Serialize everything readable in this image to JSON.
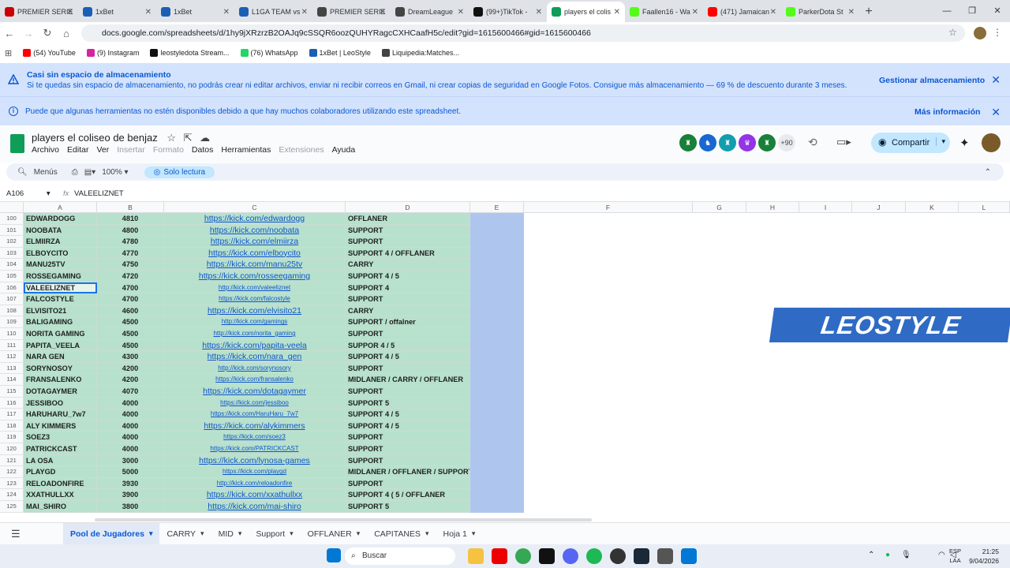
{
  "browser": {
    "tabs": [
      {
        "label": "PREMIER SERIE",
        "color": "#c00"
      },
      {
        "label": "1xBet",
        "color": "#1a5fb4"
      },
      {
        "label": "1xBet",
        "color": "#1a5fb4"
      },
      {
        "label": "L1GA TEAM vs",
        "color": "#1a5fb4"
      },
      {
        "label": "PREMIER SERIE",
        "color": "#444"
      },
      {
        "label": "DreamLeague",
        "color": "#444"
      },
      {
        "label": "(99+)TikTok -",
        "color": "#111"
      },
      {
        "label": "players el colis",
        "color": "#0f9d58",
        "active": true
      },
      {
        "label": "Faallen16 - Wa",
        "color": "#53fc18"
      },
      {
        "label": "(471) Jamaican",
        "color": "#f00"
      },
      {
        "label": "ParkerDota St",
        "color": "#53fc18"
      }
    ],
    "url": "docs.google.com/spreadsheets/d/1hy9jXRzrzB2OAJq9cSSQR6oozQUHYRagcCXHCaafH5c/edit?gid=1615600466#gid=1615600466",
    "bookmarks": [
      "(54) YouTube",
      "(9) Instagram",
      "leostyledota Stream...",
      "(76) WhatsApp",
      "1xBet | LeoStyle",
      "Liquipedia:Matches..."
    ]
  },
  "banner_storage": {
    "title": "Casi sin espacio de almacenamiento",
    "text": "Si te quedas sin espacio de almacenamiento, no podrás crear ni editar archivos, enviar ni recibir correos en Gmail, ni crear copias de seguridad en Google Fotos. Consigue más almacenamiento — 69 % de descuento durante 3 meses.",
    "action": "Gestionar almacenamiento"
  },
  "banner_collab": {
    "text": "Puede que algunas herramientas no estén disponibles debido a que hay muchos colaboradores utilizando este spreadsheet.",
    "action": "Más información"
  },
  "doc": {
    "title": "players el coliseo de benjaz",
    "menus": [
      {
        "label": "Archivo"
      },
      {
        "label": "Editar"
      },
      {
        "label": "Ver"
      },
      {
        "label": "Insertar",
        "disabled": true
      },
      {
        "label": "Formato",
        "disabled": true
      },
      {
        "label": "Datos"
      },
      {
        "label": "Herramientas"
      },
      {
        "label": "Extensiones",
        "disabled": true
      },
      {
        "label": "Ayuda"
      }
    ],
    "collaborators_more": "+90",
    "share_label": "Compartir"
  },
  "toolbar": {
    "menus_label": "Menús",
    "zoom": "100%",
    "readonly_label": "Solo lectura"
  },
  "formula_bar": {
    "name_box": "A106",
    "value": "VALEELIZNET"
  },
  "columns": [
    "A",
    "B",
    "C",
    "D",
    "E",
    "F",
    "G",
    "H",
    "I",
    "J",
    "K",
    "L"
  ],
  "rows": [
    {
      "n": "100",
      "name": "EDWARDOGG",
      "score": "4810",
      "link": "https://kick.com/edwardogg",
      "role": "OFFLANER"
    },
    {
      "n": "101",
      "name": "NOOBATA",
      "score": "4800",
      "link": "https://kick.com/noobata",
      "role": "SUPPORT"
    },
    {
      "n": "102",
      "name": "ELMIIRZA",
      "score": "4780",
      "link": "https://kick.com/elmiirza",
      "role": "SUPPORT"
    },
    {
      "n": "103",
      "name": "ELBOYCITO",
      "score": "4770",
      "link": "https://kick.com/elboycito",
      "role": "SUPPORT 4 / OFFLANER"
    },
    {
      "n": "104",
      "name": "MANU25TV",
      "score": "4750",
      "link": "https://kick.com/manu25tv",
      "role": "CARRY"
    },
    {
      "n": "105",
      "name": "ROSSEGAMING",
      "score": "4720",
      "link": "https://kick.com/rosseegaming",
      "role": "SUPPORT 4 / 5"
    },
    {
      "n": "106",
      "name": "VALEELIZNET",
      "score": "4700",
      "link": "http://kick.com/valeeliznet",
      "role": "SUPPORT 4",
      "selected": true,
      "small": true
    },
    {
      "n": "107",
      "name": "FALCOSTYLE",
      "score": "4700",
      "link": "https://kick.com/falcostyle",
      "role": "SUPPORT",
      "small": true
    },
    {
      "n": "108",
      "name": "ELVISITO21",
      "score": "4600",
      "link": "https://kick.com/elvisito21",
      "role": "CARRY"
    },
    {
      "n": "109",
      "name": "BALIGAMING",
      "score": "4500",
      "link": "http://kick.com/gamings",
      "role": "SUPPORT / offalner",
      "small": true
    },
    {
      "n": "110",
      "name": "NORITA GAMING",
      "score": "4500",
      "link": "http://kick.com/norita_gaming",
      "role": "SUPPORT",
      "small": true
    },
    {
      "n": "111",
      "name": "PAPITA_VEELA",
      "score": "4500",
      "link": "https://kick.com/papita-veela",
      "role": "SUPPOR 4 / 5"
    },
    {
      "n": "112",
      "name": "NARA GEN",
      "score": "4300",
      "link": "https://kick.com/nara_gen",
      "role": "SUPPORT 4 / 5"
    },
    {
      "n": "113",
      "name": "SORYNOSOY",
      "score": "4200",
      "link": "http://kick.com/sorynosory",
      "role": "SUPPORT",
      "small": true
    },
    {
      "n": "114",
      "name": "FRANSALENKO",
      "score": "4200",
      "link": "https://kick.com/fransalenko",
      "role": "MIDLANER / CARRY / OFFLANER",
      "small": true
    },
    {
      "n": "115",
      "name": "DOTAGAYMER",
      "score": "4070",
      "link": "https://kick.com/dotagaymer",
      "role": "SUPPORT"
    },
    {
      "n": "116",
      "name": "JESSIBOO",
      "score": "4000",
      "link": "https://kick.com/jessiboo",
      "role": "SUPPORT 5",
      "small": true
    },
    {
      "n": "117",
      "name": "HARUHARU_7w7",
      "score": "4000",
      "link": "https://kick.com/HaruHaru_7w7",
      "role": "SUPPORT 4 / 5",
      "small": true
    },
    {
      "n": "118",
      "name": "ALY KIMMERS",
      "score": "4000",
      "link": "https://kick.com/alykimmers",
      "role": "SUPPORT 4 / 5"
    },
    {
      "n": "119",
      "name": "SOEZ3",
      "score": "4000",
      "link": "https://kick.com/soez3",
      "role": "SUPPORT",
      "small": true
    },
    {
      "n": "120",
      "name": "PATRICKCAST",
      "score": "4000",
      "link": "https://kick.com/PATRICKCAST",
      "role": "SUPPORT",
      "small": true
    },
    {
      "n": "121",
      "name": "LA OSA",
      "score": "3000",
      "link": "https://kick.com/lynosa-games",
      "role": "SUPPORT"
    },
    {
      "n": "122",
      "name": "PLAYGD",
      "score": "5000",
      "link": "https://kick.com/playgd",
      "role": "MIDLANER / OFFLANER / SUPPORT",
      "small": true
    },
    {
      "n": "123",
      "name": "RELOADONFIRE",
      "score": "3930",
      "link": "http://kick.com/reloadonfire",
      "role": "SUPPORT",
      "small": true
    },
    {
      "n": "124",
      "name": "XXATHULLXX",
      "score": "3900",
      "link": "https://kick.com/xxathullxx",
      "role": "SUPPORT 4 ( 5 / OFFLANER"
    },
    {
      "n": "125",
      "name": "MAI_SHIRO",
      "score": "3800",
      "link": "https://kick.com/mai-shiro",
      "role": "SUPPORT 5"
    }
  ],
  "watermark": "LEOSTYLE",
  "sheet_tabs": [
    {
      "label": "Pool de Jugadores",
      "active": true
    },
    {
      "label": "CARRY"
    },
    {
      "label": "MID"
    },
    {
      "label": "Support"
    },
    {
      "label": "OFFLANER"
    },
    {
      "label": "CAPITANES"
    },
    {
      "label": "Hoja 1"
    }
  ],
  "taskbar": {
    "search": "Buscar",
    "lang_1": "ESP",
    "lang_2": "LAA",
    "time": "21:25",
    "date": "9/04/2026"
  }
}
